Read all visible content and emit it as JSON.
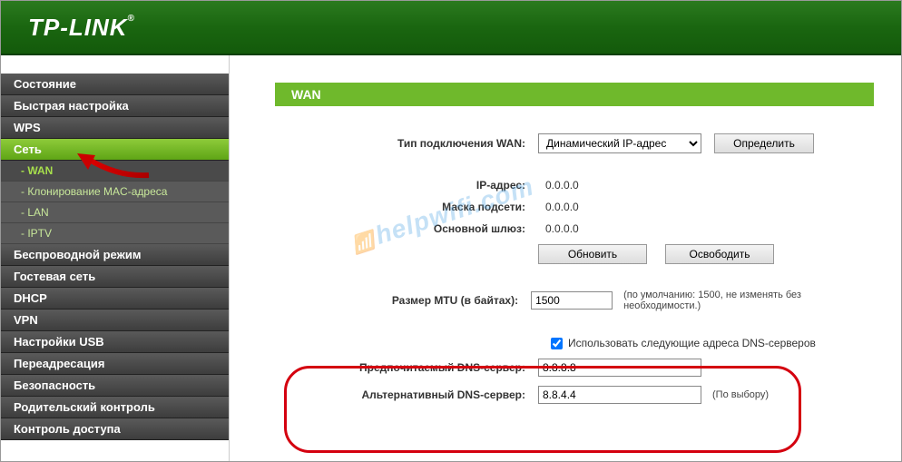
{
  "logo": "TP-LINK",
  "nav": {
    "items": [
      {
        "label": "Состояние"
      },
      {
        "label": "Быстрая настройка"
      },
      {
        "label": "WPS"
      },
      {
        "label": "Сеть",
        "active": true
      },
      {
        "label": "Беспроводной режим"
      },
      {
        "label": "Гостевая сеть"
      },
      {
        "label": "DHCP"
      },
      {
        "label": "VPN"
      },
      {
        "label": "Настройки USB"
      },
      {
        "label": "Переадресация"
      },
      {
        "label": "Безопасность"
      },
      {
        "label": "Родительский контроль"
      },
      {
        "label": "Контроль доступа"
      }
    ],
    "subitems": [
      {
        "label": "- WAN",
        "active": true
      },
      {
        "label": "- Клонирование MAC-адреса"
      },
      {
        "label": "- LAN"
      },
      {
        "label": "- IPTV"
      }
    ]
  },
  "panel": {
    "title": "WAN",
    "conn_type_label": "Тип подключения WAN:",
    "conn_type_value": "Динамический IP-адрес",
    "detect_btn": "Определить",
    "ip_label": "IP-адрес:",
    "ip_value": "0.0.0.0",
    "mask_label": "Маска подсети:",
    "mask_value": "0.0.0.0",
    "gw_label": "Основной шлюз:",
    "gw_value": "0.0.0.0",
    "renew_btn": "Обновить",
    "release_btn": "Освободить",
    "mtu_label": "Размер MTU (в байтах):",
    "mtu_value": "1500",
    "mtu_hint": "(по умолчанию: 1500, не изменять без необходимости.)",
    "use_dns_label": "Использовать следующие адреса DNS-серверов",
    "use_dns_checked": true,
    "dns1_label": "Предпочитаемый DNS-сервер:",
    "dns1_value": "8.8.8.8",
    "dns2_label": "Альтернативный DNS-сервер:",
    "dns2_value": "8.8.4.4",
    "dns2_hint": "(По выбору)"
  },
  "watermark": "helpwifi.com"
}
